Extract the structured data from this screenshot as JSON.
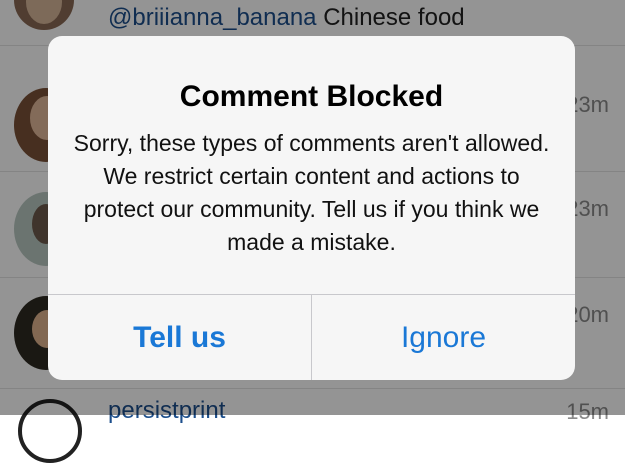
{
  "feed": {
    "first_row": {
      "handle": "@briiianna_banana",
      "text": " Chinese food"
    },
    "rows": [
      {
        "time": "23m"
      },
      {
        "time": "23m"
      },
      {
        "time": "20m"
      }
    ],
    "last_row": {
      "handle": "persistprint",
      "time": "15m"
    }
  },
  "alert": {
    "title": "Comment Blocked",
    "message": "Sorry, these types of comments aren't allowed. We restrict certain content and actions to protect our community. Tell us if you think we made a mistake.",
    "buttons": {
      "tell_us": "Tell us",
      "ignore": "Ignore"
    }
  }
}
